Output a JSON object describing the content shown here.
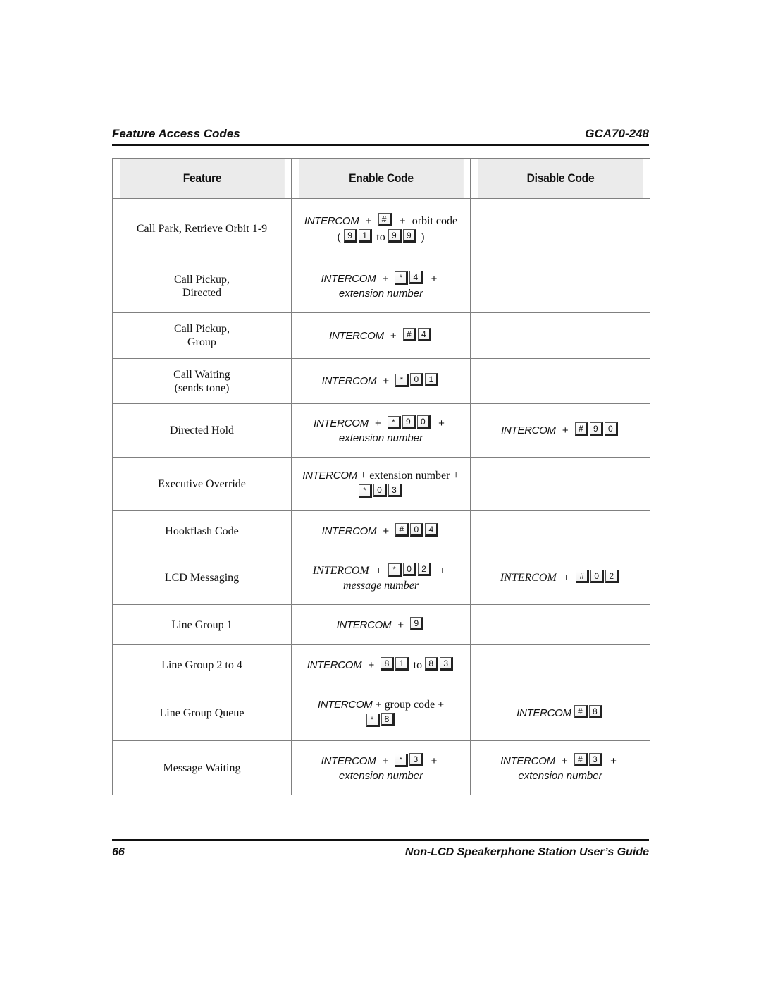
{
  "page_header": {
    "section_title": "Feature Access Codes",
    "doc_code": "GCA70-248"
  },
  "page_footer": {
    "page_number": "66",
    "guide_title": "Non-LCD Speakerphone Station User’s Guide"
  },
  "table": {
    "columns": [
      "Feature",
      "Enable Code",
      "Disable Code"
    ],
    "rows": [
      {
        "feature": [
          "Call Park, Retrieve Orbit 1-9"
        ],
        "enable": {
          "prefix": "INTERCOM",
          "keys": [
            "#"
          ],
          "suffix": "orbit code",
          "range_open": "(",
          "range_from": [
            "9",
            "1"
          ],
          "range_word": "to",
          "range_to": [
            "9",
            "9"
          ],
          "range_close": ")"
        },
        "disable": null
      },
      {
        "feature": [
          "Call Pickup,",
          "Directed"
        ],
        "enable": {
          "prefix": "INTERCOM",
          "keys": [
            "*",
            "4"
          ],
          "note": "extension number"
        },
        "disable": null
      },
      {
        "feature": [
          "Call Pickup,",
          "Group"
        ],
        "enable": {
          "prefix": "INTERCOM",
          "keys": [
            "#",
            "4"
          ]
        },
        "disable": null
      },
      {
        "feature": [
          "Call Waiting",
          "(sends tone)"
        ],
        "enable": {
          "prefix": "INTERCOM",
          "keys": [
            "*",
            "0",
            "1"
          ]
        },
        "disable": null
      },
      {
        "feature": [
          "Directed Hold"
        ],
        "enable": {
          "prefix": "INTERCOM",
          "keys": [
            "*",
            "9",
            "0"
          ],
          "note": "extension number"
        },
        "disable": {
          "prefix": "INTERCOM",
          "keys": [
            "#",
            "9",
            "0"
          ]
        }
      },
      {
        "feature": [
          "Executive Override"
        ],
        "enable": {
          "prefix": "INTERCOM",
          "middle": "extension number",
          "keys": [
            "*",
            "0",
            "3"
          ]
        },
        "disable": null
      },
      {
        "feature": [
          "Hookflash Code"
        ],
        "enable": {
          "prefix": "INTERCOM",
          "keys": [
            "#",
            "0",
            "4"
          ]
        },
        "disable": null
      },
      {
        "feature": [
          "LCD Messaging"
        ],
        "enable": {
          "prefix": "INTERCOM",
          "keys": [
            "*",
            "0",
            "2"
          ],
          "note": "message number"
        },
        "disable": {
          "prefix": "INTERCOM",
          "keys": [
            "#",
            "0",
            "2"
          ]
        }
      },
      {
        "feature": [
          "Line Group 1"
        ],
        "enable": {
          "prefix": "INTERCOM",
          "keys": [
            "9"
          ]
        },
        "disable": null
      },
      {
        "feature": [
          "Line Group 2 to 4"
        ],
        "enable": {
          "prefix": "INTERCOM",
          "range_from": [
            "8",
            "1"
          ],
          "range_word": "to",
          "range_to": [
            "8",
            "3"
          ]
        },
        "disable": null
      },
      {
        "feature": [
          "Line Group Queue"
        ],
        "enable": {
          "prefix": "INTERCOM",
          "middle": "group code",
          "keys": [
            "*",
            "8"
          ]
        },
        "disable": {
          "prefix": "INTERCOM",
          "keys": [
            "#",
            "8"
          ]
        }
      },
      {
        "feature": [
          "Message Waiting"
        ],
        "enable": {
          "prefix": "INTERCOM",
          "keys": [
            "*",
            "3"
          ],
          "note": "extension number"
        },
        "disable": {
          "prefix": "INTERCOM",
          "keys": [
            "#",
            "3"
          ],
          "note": "extension number"
        }
      }
    ]
  },
  "symbols": {
    "plus": "+"
  }
}
